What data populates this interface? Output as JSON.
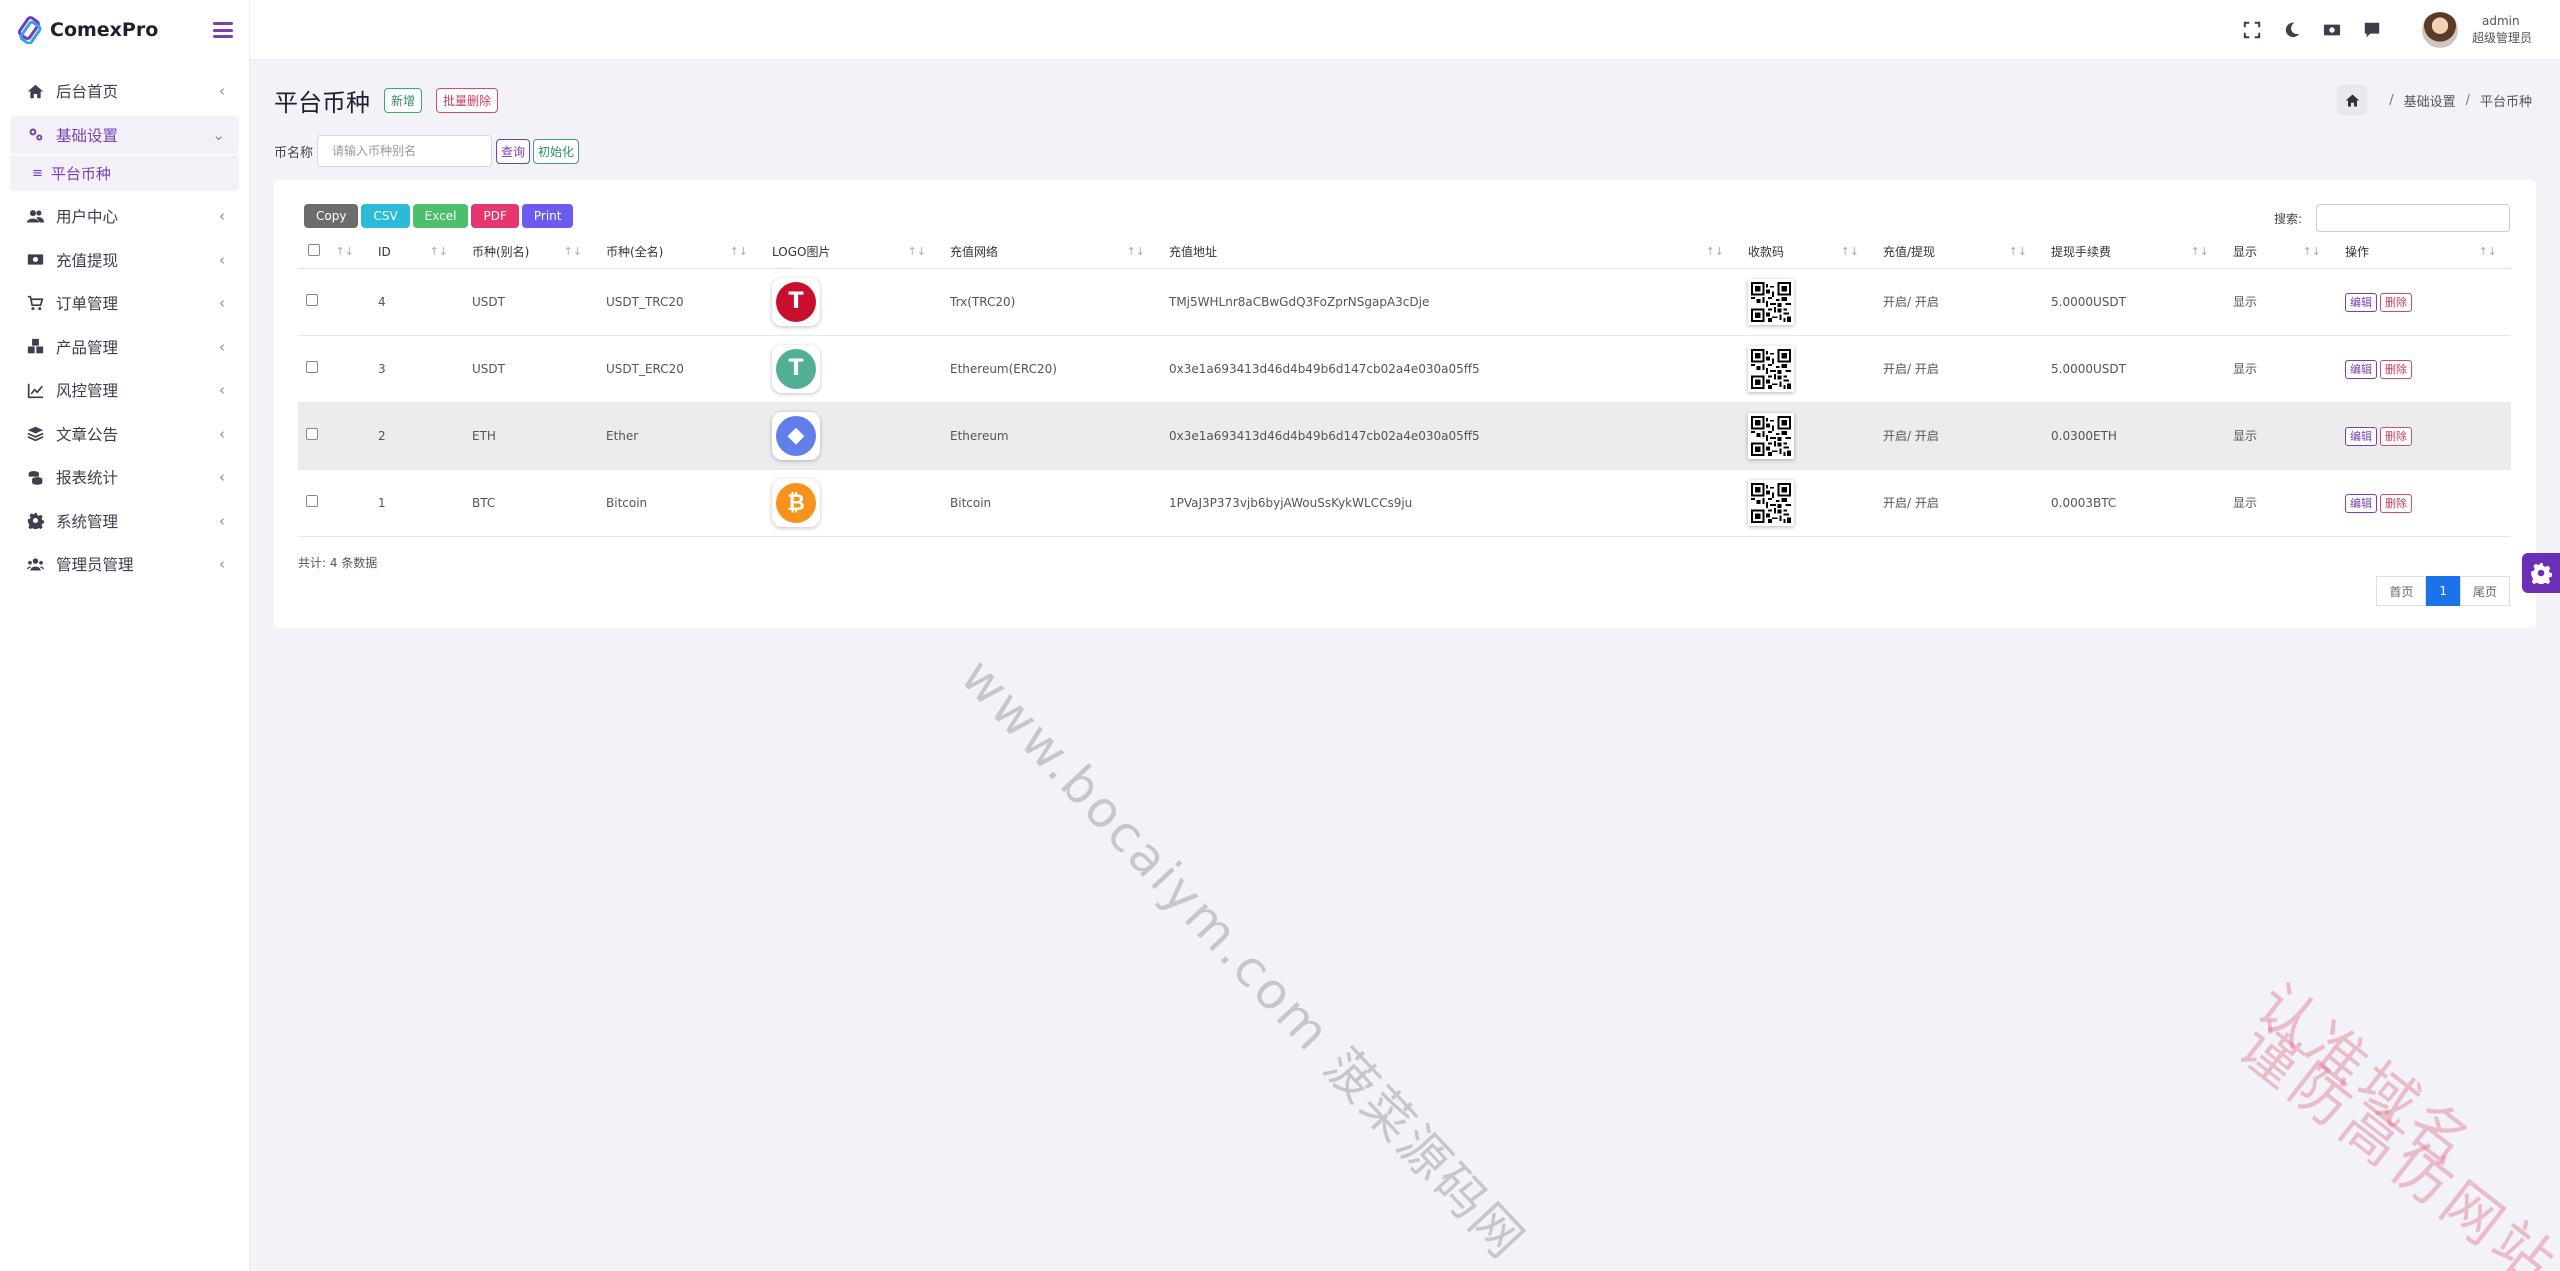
{
  "app": {
    "name": "ComexPro"
  },
  "sidebar": {
    "items": [
      {
        "label": "后台首页",
        "icon": "home-icon"
      },
      {
        "label": "基础设置",
        "icon": "cogs-icon",
        "open": true,
        "sub": [
          {
            "label": "平台币种"
          }
        ]
      },
      {
        "label": "用户中心",
        "icon": "users-icon"
      },
      {
        "label": "充值提现",
        "icon": "money-icon"
      },
      {
        "label": "订单管理",
        "icon": "cart-icon"
      },
      {
        "label": "产品管理",
        "icon": "cubes-icon"
      },
      {
        "label": "风控管理",
        "icon": "chart-line-icon"
      },
      {
        "label": "文章公告",
        "icon": "layers-icon"
      },
      {
        "label": "报表统计",
        "icon": "coins-icon"
      },
      {
        "label": "系统管理",
        "icon": "gear-icon"
      },
      {
        "label": "管理员管理",
        "icon": "user-group-icon"
      }
    ]
  },
  "topbar": {
    "user_name": "admin",
    "user_role": "超级管理员"
  },
  "page": {
    "title": "平台币种",
    "add_label": "新增",
    "batch_delete_label": "批量删除",
    "breadcrumb": [
      "基础设置",
      "平台币种"
    ]
  },
  "filter": {
    "label": "币名称",
    "placeholder": "请输入币种别名",
    "query_label": "查询",
    "init_label": "初始化"
  },
  "toolbar": {
    "exports": [
      {
        "label": "Copy",
        "color": "#6c6c6c"
      },
      {
        "label": "CSV",
        "color": "#2bbbd8"
      },
      {
        "label": "Excel",
        "color": "#4cbf6b"
      },
      {
        "label": "PDF",
        "color": "#e6356f"
      },
      {
        "label": "Print",
        "color": "#6a5cf0"
      }
    ],
    "search_label": "搜索:"
  },
  "table": {
    "headers": [
      "ID",
      "币种(别名)",
      "币种(全名)",
      "LOGO图片",
      "充值网络",
      "充值地址",
      "收款码",
      "充值/提现",
      "提现手续费",
      "显示",
      "操作"
    ],
    "rows": [
      {
        "id": "4",
        "alias": "USDT",
        "full": "USDT_TRC20",
        "logo": "tron",
        "logo_color": "#c8102e",
        "logo_glyph": "T",
        "network": "Trx(TRC20)",
        "address": "TMj5WHLnr8aCBwGdQ3FoZprNSgapA3cDje",
        "status": "开启/ 开启",
        "fee": "5.0000USDT",
        "show": "显示",
        "highlight": false
      },
      {
        "id": "3",
        "alias": "USDT",
        "full": "USDT_ERC20",
        "logo": "tether",
        "logo_color": "#50af95",
        "logo_glyph": "T",
        "network": "Ethereum(ERC20)",
        "address": "0x3e1a693413d46d4b49b6d147cb02a4e030a05ff5",
        "status": "开启/ 开启",
        "fee": "5.0000USDT",
        "show": "显示",
        "highlight": false
      },
      {
        "id": "2",
        "alias": "ETH",
        "full": "Ether",
        "logo": "ethereum",
        "logo_color": "#627eea",
        "logo_glyph": "◆",
        "network": "Ethereum",
        "address": "0x3e1a693413d46d4b49b6d147cb02a4e030a05ff5",
        "status": "开启/ 开启",
        "fee": "0.0300ETH",
        "show": "显示",
        "highlight": true
      },
      {
        "id": "1",
        "alias": "BTC",
        "full": "Bitcoin",
        "logo": "bitcoin",
        "logo_color": "#f7931a",
        "logo_glyph": "₿",
        "network": "Bitcoin",
        "address": "1PVaJ3P373vjb6byjAWouSsKykWLCCs9ju",
        "status": "开启/ 开启",
        "fee": "0.0003BTC",
        "show": "显示",
        "highlight": false
      }
    ],
    "edit_label": "编辑",
    "delete_label": "删除"
  },
  "footer": {
    "total": "共计: 4 条数据"
  },
  "pagination": {
    "first": "首页",
    "current": "1",
    "last": "尾页"
  },
  "watermarks": [
    "www.bocaiym.com 菠菜源码网",
    "认准域名",
    "谨防高仿网站"
  ],
  "colors": {
    "accent": "#7a3fb5",
    "page_active": "#1a73e8"
  }
}
